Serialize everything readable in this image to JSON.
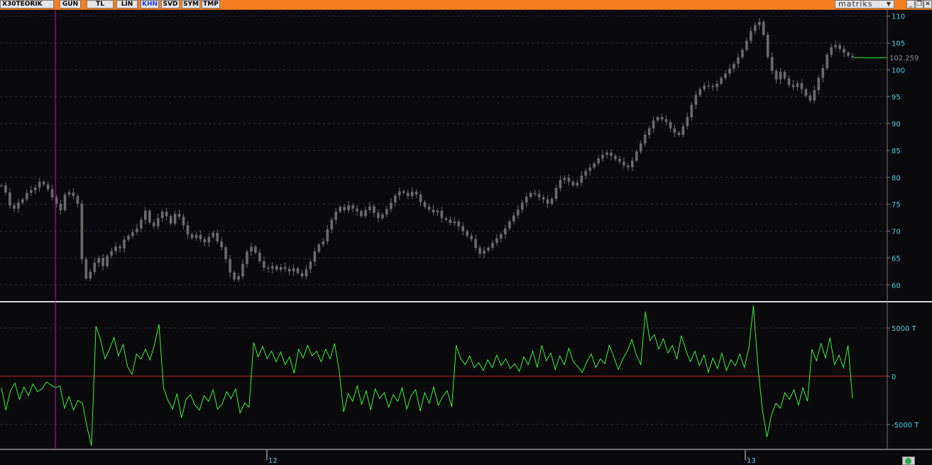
{
  "toolbar": {
    "symbol": "X30TEORIK",
    "buttons": [
      {
        "label": "GUN",
        "active": false
      },
      {
        "label": "TL",
        "active": false
      },
      {
        "label": "LIN",
        "active": false
      },
      {
        "label": "KHN",
        "active": true
      },
      {
        "label": "SVD",
        "active": false
      },
      {
        "label": "SYM",
        "active": false
      },
      {
        "label": "TMP",
        "active": false
      }
    ],
    "brand": "matriks",
    "brand_caret_icon": "dropdown-caret-icon",
    "window_icons": [
      "minimize-icon",
      "restore-icon",
      "close-icon"
    ]
  },
  "colors": {
    "toolbar_bg": "#f57f20",
    "candle": "#6b6b6b",
    "indicator": "#3cf03c",
    "zero_line": "#c02020",
    "axis_text": "#4fd0e6",
    "current_price_line": "#3cf03c",
    "vertical_marker": "#a0209c"
  },
  "chart_data": [
    {
      "type": "candlestick",
      "title": "",
      "ylim": [
        57,
        111
      ],
      "yticks": [
        60,
        65,
        70,
        75,
        80,
        85,
        90,
        95,
        100,
        105,
        110
      ],
      "current_value": "102.259",
      "close_series": [
        78.5,
        77.2,
        74.8,
        74.2,
        75.3,
        75.9,
        77.1,
        77.6,
        78.1,
        79.2,
        78.7,
        77.8,
        76.3,
        75.1,
        73.9,
        76.8,
        77.2,
        76.5,
        75.1,
        64.8,
        61.2,
        62.4,
        64.1,
        65.0,
        63.5,
        65.4,
        66.3,
        67.1,
        66.8,
        68.4,
        69.1,
        69.8,
        70.5,
        72.1,
        73.8,
        71.6,
        70.9,
        72.4,
        73.6,
        72.8,
        71.4,
        73.2,
        72.7,
        71.1,
        69.4,
        68.7,
        69.3,
        68.5,
        67.9,
        68.9,
        69.7,
        68.1,
        67.0,
        64.8,
        62.3,
        61.0,
        61.6,
        63.9,
        66.2,
        67.1,
        66.0,
        64.4,
        63.2,
        63.0,
        63.5,
        62.8,
        63.3,
        63.0,
        62.5,
        63.1,
        62.2,
        61.6,
        62.9,
        64.3,
        66.2,
        67.5,
        68.1,
        70.3,
        72.1,
        73.6,
        74.5,
        73.9,
        74.8,
        74.2,
        73.7,
        72.8,
        73.9,
        74.6,
        73.4,
        72.4,
        73.1,
        74.1,
        75.3,
        76.6,
        77.4,
        77.1,
        76.5,
        77.3,
        76.8,
        75.4,
        74.5,
        74.0,
        73.5,
        73.8,
        72.4,
        72.1,
        71.5,
        71.8,
        70.9,
        70.0,
        69.1,
        68.5,
        66.9,
        65.8,
        66.4,
        66.9,
        67.8,
        68.6,
        69.4,
        70.5,
        71.8,
        72.9,
        74.0,
        75.3,
        76.4,
        77.1,
        76.9,
        76.3,
        75.9,
        75.1,
        76.0,
        78.0,
        79.5,
        79.9,
        79.2,
        78.5,
        79.0,
        80.3,
        81.2,
        81.8,
        82.6,
        83.5,
        84.2,
        84.6,
        84.0,
        83.4,
        82.9,
        82.2,
        81.9,
        83.1,
        84.8,
        86.3,
        87.9,
        89.1,
        90.6,
        91.2,
        90.8,
        90.3,
        89.1,
        88.3,
        87.9,
        89.5,
        91.2,
        93.5,
        95.3,
        96.4,
        97.1,
        97.0,
        96.8,
        97.4,
        98.5,
        99.3,
        100.2,
        101.1,
        102.3,
        103.7,
        105.4,
        107.2,
        108.3,
        108.9,
        106.5,
        102.4,
        99.8,
        98.2,
        99.6,
        98.4,
        97.2,
        96.8,
        97.5,
        96.4,
        95.2,
        94.3,
        96.2,
        98.5,
        100.3,
        102.8,
        104.2,
        104.6,
        103.9,
        103.2,
        102.6,
        102.3
      ]
    },
    {
      "type": "line",
      "title": "",
      "ylim": [
        -7500,
        7500
      ],
      "yticks": [
        {
          "value": 5000,
          "label": "5000 T"
        },
        {
          "value": 0,
          "label": "0"
        },
        {
          "value": -5000,
          "label": "-5000 T"
        }
      ],
      "reference_line": 0,
      "values": [
        -1200,
        -3500,
        -1500,
        -700,
        -2400,
        -1100,
        -2000,
        -800,
        -1600,
        -1300,
        -600,
        -900,
        -1200,
        -1000,
        -3300,
        -2100,
        -3500,
        -2500,
        -2800,
        -5200,
        -7200,
        5200,
        3800,
        1800,
        2800,
        4000,
        2100,
        3300,
        1000,
        200,
        2300,
        1800,
        2800,
        1700,
        3300,
        5400,
        -1200,
        -2500,
        -3400,
        -1800,
        -4300,
        -2400,
        -1900,
        -3000,
        -3500,
        -2000,
        -2600,
        -1400,
        -3400,
        -2900,
        -1600,
        -2300,
        -1300,
        -3800,
        -2800,
        -3200,
        3500,
        2000,
        3100,
        1800,
        2600,
        1500,
        2500,
        1200,
        2000,
        300,
        2800,
        1900,
        3200,
        2100,
        2600,
        1500,
        2800,
        1800,
        3400,
        600,
        -3700,
        -1800,
        -2600,
        -1000,
        -2900,
        -1500,
        -3500,
        -1300,
        -2300,
        -1700,
        -3200,
        -1900,
        -2600,
        -1200,
        -3400,
        -2000,
        -1400,
        -3600,
        -1700,
        -2800,
        -1100,
        -3000,
        -2100,
        -1500,
        -3200,
        3200,
        1800,
        1200,
        2100,
        900,
        1400,
        600,
        1700,
        900,
        2200,
        1100,
        1800,
        800,
        1300,
        500,
        2000,
        1200,
        2600,
        900,
        3200,
        1600,
        2400,
        700,
        2100,
        1200,
        2900,
        1500,
        1000,
        400,
        1500,
        2300,
        900,
        1800,
        1300,
        3200,
        2000,
        700,
        1800,
        2600,
        3800,
        2200,
        1200,
        6700,
        3700,
        4300,
        2800,
        3900,
        2400,
        3200,
        1800,
        4200,
        2700,
        1500,
        2600,
        1100,
        2200,
        400,
        1900,
        800,
        2400,
        600,
        1700,
        1100,
        2300,
        900,
        3000,
        7300,
        1000,
        -3500,
        -6300,
        -4000,
        -2800,
        -3300,
        -1700,
        -2400,
        -1400,
        -3000,
        -1200,
        -2600,
        2800,
        1600,
        3400,
        1900,
        4000,
        1200,
        2200,
        900,
        3200,
        -2300
      ]
    }
  ],
  "x_axis": {
    "date_labels": [
      "12",
      "13"
    ]
  },
  "refresh_icon": "refresh-icon"
}
